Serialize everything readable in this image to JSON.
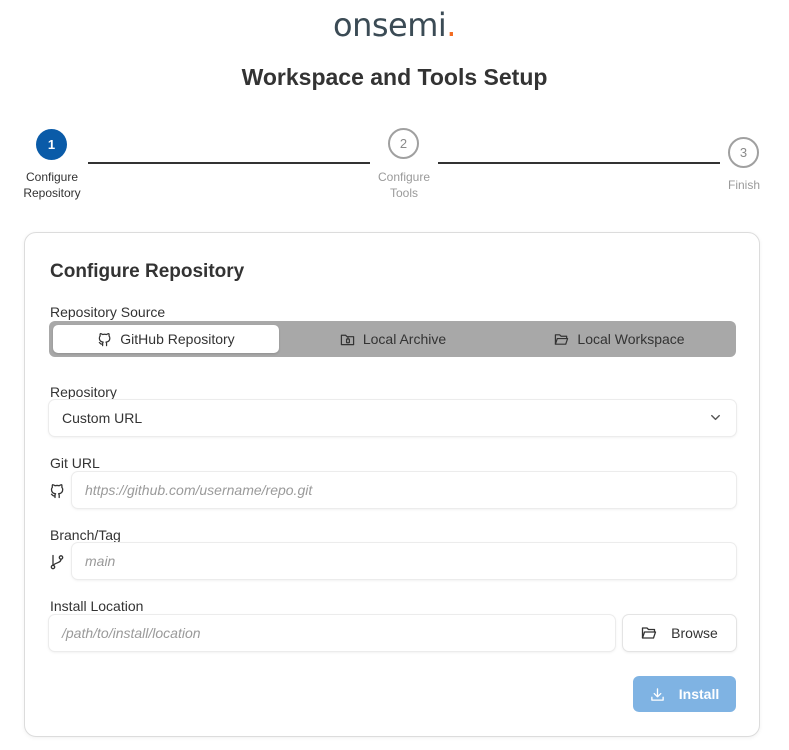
{
  "header": {
    "logo_text": "onsemi",
    "logo_dot": ".",
    "title": "Workspace and Tools Setup"
  },
  "stepper": {
    "steps": [
      {
        "number": "1",
        "label_line1": "Configure",
        "label_line2": "Repository",
        "state": "active"
      },
      {
        "number": "2",
        "label_line1": "Configure",
        "label_line2": "Tools",
        "state": "inactive"
      },
      {
        "number": "3",
        "label_line1": "Finish",
        "label_line2": "",
        "state": "inactive"
      }
    ]
  },
  "form": {
    "title": "Configure Repository",
    "source": {
      "label": "Repository Source",
      "options": [
        {
          "label": "GitHub Repository",
          "icon": "github-icon",
          "selected": true
        },
        {
          "label": "Local Archive",
          "icon": "archive-folder-icon",
          "selected": false
        },
        {
          "label": "Local Workspace",
          "icon": "folder-open-icon",
          "selected": false
        }
      ]
    },
    "repository": {
      "label": "Repository",
      "value": "Custom URL"
    },
    "git_url": {
      "label": "Git URL",
      "placeholder": "https://github.com/username/repo.git"
    },
    "branch": {
      "label": "Branch/Tag",
      "placeholder": "main"
    },
    "install_location": {
      "label": "Install Location",
      "placeholder": "/path/to/install/location",
      "browse_label": "Browse"
    },
    "install_label": "Install"
  },
  "colors": {
    "accent": "#0a5ba8",
    "install_disabled": "#7fb3e3",
    "logo_text": "#3b4b55",
    "logo_accent": "#f26b21"
  }
}
